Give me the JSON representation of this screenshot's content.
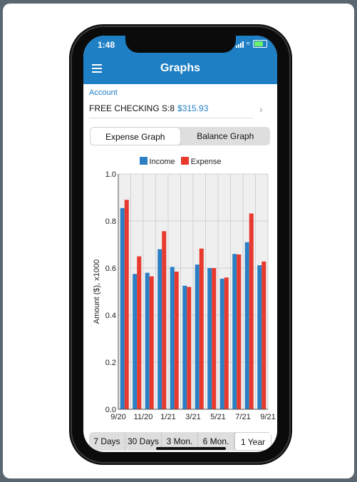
{
  "status": {
    "time": "1:48"
  },
  "header": {
    "title": "Graphs"
  },
  "account": {
    "label": "Account",
    "name": "FREE CHECKING S:8",
    "balance": "$315.93"
  },
  "tabs": [
    {
      "label": "Expense Graph",
      "active": true
    },
    {
      "label": "Balance Graph",
      "active": false
    }
  ],
  "chart_data": {
    "type": "bar",
    "ylabel": "Amount ($), x1000",
    "ylim": [
      0.0,
      1.0
    ],
    "yticks": [
      "0.0",
      "0.2",
      "0.4",
      "0.6",
      "0.8",
      "1.0"
    ],
    "xtick_labels": [
      "9/20",
      "11/20",
      "1/21",
      "3/21",
      "5/21",
      "7/21",
      "9/21"
    ],
    "series": [
      {
        "name": "Income",
        "color": "#2b7fc4",
        "values": [
          0.855,
          0.575,
          0.58,
          0.68,
          0.605,
          0.525,
          0.615,
          0.6,
          0.555,
          0.66,
          0.71,
          0.612
        ]
      },
      {
        "name": "Expense",
        "color": "#e8392e",
        "values": [
          0.89,
          0.65,
          0.565,
          0.757,
          0.585,
          0.52,
          0.683,
          0.6,
          0.56,
          0.658,
          0.832,
          0.628
        ]
      }
    ],
    "grid": true,
    "legend": "top"
  },
  "range_buttons": [
    {
      "label": "7 Days",
      "active": false
    },
    {
      "label": "30 Days",
      "active": false
    },
    {
      "label": "3 Mon.",
      "active": false
    },
    {
      "label": "6 Mon.",
      "active": false
    },
    {
      "label": "1 Year",
      "active": true
    }
  ],
  "colors": {
    "accent": "#1e7fc5",
    "income": "#2b7fc4",
    "expense": "#e8392e"
  }
}
